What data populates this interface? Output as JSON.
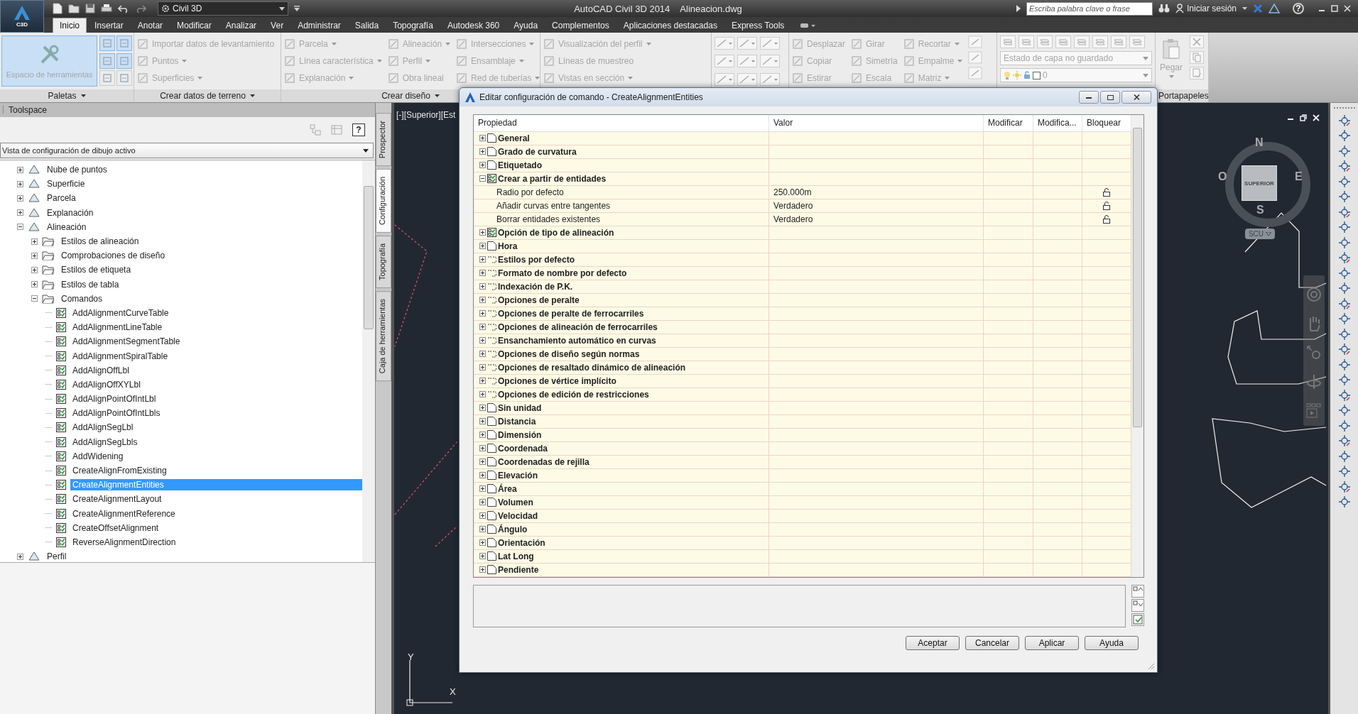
{
  "app": {
    "logo": "C3D",
    "workspace": "Civil 3D",
    "title": "AutoCAD Civil 3D 2014",
    "file": "Alineacion.dwg",
    "search_placeholder": "Escriba palabra clave o frase",
    "sign_in": "Iniciar sesión",
    "help": "?"
  },
  "ribbon_tabs": [
    {
      "label": "Inicio",
      "selected": true
    },
    {
      "label": "Insertar",
      "selected": false
    },
    {
      "label": "Anotar",
      "selected": false
    },
    {
      "label": "Modificar",
      "selected": false
    },
    {
      "label": "Analizar",
      "selected": false
    },
    {
      "label": "Ver",
      "selected": false
    },
    {
      "label": "Administrar",
      "selected": false
    },
    {
      "label": "Salida",
      "selected": false
    },
    {
      "label": "Topografía",
      "selected": false
    },
    {
      "label": "Autodesk 360",
      "selected": false
    },
    {
      "label": "Ayuda",
      "selected": false
    },
    {
      "label": "Complementos",
      "selected": false
    },
    {
      "label": "Aplicaciones destacadas",
      "selected": false
    },
    {
      "label": "Express Tools",
      "selected": false
    }
  ],
  "ribbon": {
    "panels": [
      {
        "kind": "palettes",
        "title": "Paletas",
        "large": {
          "label": "Espacio de herramientas",
          "selected": true
        },
        "toggles": [
          {
            "on": true
          },
          {
            "on": true
          },
          {
            "on": true
          },
          {
            "on": true
          },
          {
            "on": false
          },
          {
            "on": false
          }
        ]
      },
      {
        "kind": "columns",
        "title": "Crear datos de terreno",
        "columns": [
          [
            {
              "label": "Importar datos de levantamiento",
              "dropdown": false
            },
            {
              "label": "Puntos",
              "dropdown": true
            },
            {
              "label": "Superficies",
              "dropdown": true
            }
          ]
        ]
      },
      {
        "kind": "columns",
        "title": "Crear diseño",
        "columns": [
          [
            {
              "label": "Parcela",
              "dropdown": true
            },
            {
              "label": "Línea característica",
              "dropdown": true
            },
            {
              "label": "Explanación",
              "dropdown": true
            }
          ],
          [
            {
              "label": "Alineación",
              "dropdown": true
            },
            {
              "label": "Perfil",
              "dropdown": true
            },
            {
              "label": "Obra lineal",
              "dropdown": false
            }
          ],
          [
            {
              "label": "Intersecciones",
              "dropdown": true
            },
            {
              "label": "Ensamblaje",
              "dropdown": true
            },
            {
              "label": "Red de tuberías",
              "dropdown": true
            }
          ]
        ]
      },
      {
        "kind": "columns",
        "columns": [
          [
            {
              "label": "Visualización del perfil",
              "dropdown": true
            },
            {
              "label": "Líneas de muestreo",
              "dropdown": false
            },
            {
              "label": "Vistas en sección",
              "dropdown": true
            }
          ]
        ]
      },
      {
        "kind": "draw"
      },
      {
        "kind": "modify",
        "columns": [
          [
            {
              "label": "Desplazar",
              "dropdown": false
            },
            {
              "label": "Copiar",
              "dropdown": false
            },
            {
              "label": "Estirar",
              "dropdown": false
            }
          ],
          [
            {
              "label": "Girar",
              "dropdown": false
            },
            {
              "label": "Simetría",
              "dropdown": false
            },
            {
              "label": "Escala",
              "dropdown": false
            }
          ],
          [
            {
              "label": "Recortar",
              "dropdown": true
            },
            {
              "label": "Empalme",
              "dropdown": true
            },
            {
              "label": "Matriz",
              "dropdown": true
            }
          ]
        ]
      },
      {
        "kind": "layers",
        "dropdowns": [
          "Estado de capa no guardado",
          "0"
        ]
      },
      {
        "kind": "clipboard",
        "title": "Portapapeles",
        "large": {
          "label": "Pegar",
          "selected": false
        }
      }
    ]
  },
  "toolspace": {
    "title": "Toolspace",
    "help": "?",
    "view": "Vista de configuración de dibujo activo",
    "tree": [
      {
        "label": "Nube de puntos",
        "expanded": false,
        "selected": false
      },
      {
        "label": "Superficie",
        "expanded": false,
        "selected": false
      },
      {
        "label": "Parcela",
        "expanded": false,
        "selected": false
      },
      {
        "label": "Explanación",
        "expanded": false,
        "selected": false
      },
      {
        "label": "Alineación",
        "expanded": true,
        "selected": false,
        "children": [
          {
            "label": "Estilos de alineación",
            "expanded": false,
            "selected": false
          },
          {
            "label": "Comprobaciones de diseño",
            "expanded": false,
            "selected": false
          },
          {
            "label": "Estilos de etiqueta",
            "expanded": false,
            "selected": false
          },
          {
            "label": "Estilos de tabla",
            "expanded": false,
            "selected": false
          },
          {
            "label": "Comandos",
            "expanded": true,
            "selected": false,
            "children": [
              {
                "label": "AddAlignmentCurveTable",
                "selected": false
              },
              {
                "label": "AddAlignmentLineTable",
                "selected": false
              },
              {
                "label": "AddAlignmentSegmentTable",
                "selected": false
              },
              {
                "label": "AddAlignmentSpiralTable",
                "selected": false
              },
              {
                "label": "AddAlignOffLbl",
                "selected": false
              },
              {
                "label": "AddAlignOffXYLbl",
                "selected": false
              },
              {
                "label": "AddAlignPointOfIntLbl",
                "selected": false
              },
              {
                "label": "AddAlignPointOfIntLbls",
                "selected": false
              },
              {
                "label": "AddAlignSegLbl",
                "selected": false
              },
              {
                "label": "AddAlignSegLbls",
                "selected": false
              },
              {
                "label": "AddWidening",
                "selected": false
              },
              {
                "label": "CreateAlignFromExisting",
                "selected": false
              },
              {
                "label": "CreateAlignmentEntities",
                "selected": true
              },
              {
                "label": "CreateAlignmentLayout",
                "selected": false
              },
              {
                "label": "CreateAlignmentReference",
                "selected": false
              },
              {
                "label": "CreateOffsetAlignment",
                "selected": false
              },
              {
                "label": "ReverseAlignmentDirection",
                "selected": false
              }
            ]
          }
        ]
      },
      {
        "label": "Perfil",
        "expanded": false,
        "selected": false
      }
    ],
    "tabs": [
      {
        "label": "Prospector",
        "selected": false
      },
      {
        "label": "Configuración",
        "selected": true
      },
      {
        "label": "Topografía",
        "selected": false
      },
      {
        "label": "Caja de herramientas",
        "selected": false
      }
    ]
  },
  "viewport": {
    "label": "[-][Superior][Est",
    "viewcube": {
      "north": "N",
      "west": "O",
      "east": "E",
      "south": "S",
      "face": "SUPERIOR",
      "ucs": "SCU"
    },
    "axes": {
      "y": "Y",
      "x": "X"
    }
  },
  "dialog": {
    "title": "Editar configuración de comando - CreateAlignmentEntities",
    "columns": [
      "Propiedad",
      "Valor",
      "Modificar",
      "Modifica...",
      "Bloquear"
    ],
    "rows": [
      {
        "label": "General",
        "kind": "ambient",
        "expanded": false
      },
      {
        "label": "Grado de curvatura",
        "kind": "ambient",
        "expanded": false
      },
      {
        "label": "Etiquetado",
        "kind": "ambient",
        "expanded": false
      },
      {
        "label": "Crear a partir de entidades",
        "kind": "command",
        "expanded": true,
        "children": [
          {
            "label": "Radio por defecto",
            "value": "250.000m",
            "locked": false
          },
          {
            "label": "Añadir curvas entre tangentes",
            "value": "Verdadero",
            "locked": false
          },
          {
            "label": "Borrar entidades existentes",
            "value": "Verdadero",
            "locked": false
          }
        ]
      },
      {
        "label": "Opción de tipo de alineación",
        "kind": "command",
        "expanded": false
      },
      {
        "label": "Hora",
        "kind": "ambient",
        "expanded": false
      },
      {
        "label": "Estilos por defecto",
        "kind": "object",
        "expanded": false
      },
      {
        "label": "Formato de nombre por defecto",
        "kind": "object",
        "expanded": false
      },
      {
        "label": "Indexación de P.K.",
        "kind": "object",
        "expanded": false
      },
      {
        "label": "Opciones de peralte",
        "kind": "object",
        "expanded": false
      },
      {
        "label": "Opciones de peralte de ferrocarriles",
        "kind": "object",
        "expanded": false
      },
      {
        "label": "Opciones de alineación de ferrocarriles",
        "kind": "object",
        "expanded": false
      },
      {
        "label": "Ensanchamiento automático en curvas",
        "kind": "object",
        "expanded": false
      },
      {
        "label": "Opciones de diseño según normas",
        "kind": "object",
        "expanded": false
      },
      {
        "label": "Opciones de resaltado dinámico de alineación",
        "kind": "object",
        "expanded": false
      },
      {
        "label": "Opciones de vértice implícito",
        "kind": "object",
        "expanded": false
      },
      {
        "label": "Opciones de edición de restricciones",
        "kind": "object",
        "expanded": false
      },
      {
        "label": "Sin unidad",
        "kind": "ambient",
        "expanded": false
      },
      {
        "label": "Distancia",
        "kind": "ambient",
        "expanded": false
      },
      {
        "label": "Dimensión",
        "kind": "ambient",
        "expanded": false
      },
      {
        "label": "Coordenada",
        "kind": "ambient",
        "expanded": false
      },
      {
        "label": "Coordenadas de rejilla",
        "kind": "ambient",
        "expanded": false
      },
      {
        "label": "Elevación",
        "kind": "ambient",
        "expanded": false
      },
      {
        "label": "Área",
        "kind": "ambient",
        "expanded": false
      },
      {
        "label": "Volumen",
        "kind": "ambient",
        "expanded": false
      },
      {
        "label": "Velocidad",
        "kind": "ambient",
        "expanded": false
      },
      {
        "label": "Ángulo",
        "kind": "ambient",
        "expanded": false
      },
      {
        "label": "Orientación",
        "kind": "ambient",
        "expanded": false
      },
      {
        "label": "Lat Long",
        "kind": "ambient",
        "expanded": false
      },
      {
        "label": "Pendiente",
        "kind": "ambient",
        "expanded": false
      }
    ],
    "buttons": [
      "Aceptar",
      "Cancelar",
      "Aplicar",
      "Ayuda"
    ]
  }
}
